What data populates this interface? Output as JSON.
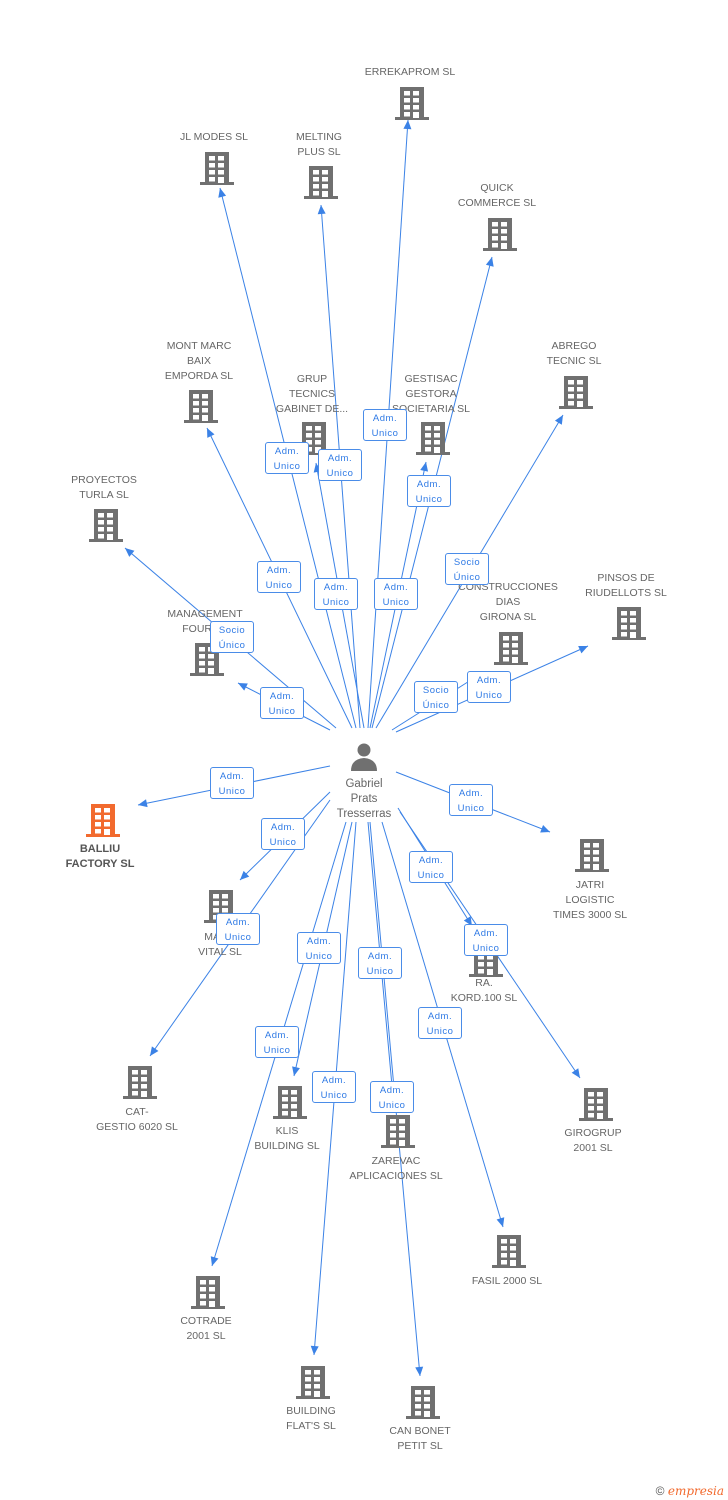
{
  "center": {
    "name_lines": [
      "Gabriel",
      "Prats",
      "Tresserras"
    ],
    "icon": "person-icon"
  },
  "colors": {
    "edge": "#3b82e6",
    "node": "#707070",
    "highlight": "#f26a2e",
    "label_text": "#2f7ae5"
  },
  "nodes": [
    {
      "lines": [
        "ERREKAPROM SL"
      ]
    },
    {
      "lines": [
        "JL MODES  SL"
      ]
    },
    {
      "lines": [
        "MELTING",
        "PLUS SL"
      ]
    },
    {
      "lines": [
        "QUICK",
        "COMMERCE SL"
      ]
    },
    {
      "lines": [
        "MONT MARC",
        "BAIX",
        "EMPORDA SL"
      ]
    },
    {
      "lines": [
        "GRUP",
        "TECNICS",
        "GABINET DE..."
      ]
    },
    {
      "lines": [
        "GESTISAC",
        "GESTORA",
        "SOCIETARIA SL"
      ]
    },
    {
      "lines": [
        "ABREGO",
        "TECNIC SL"
      ]
    },
    {
      "lines": [
        "PROYECTOS",
        "TURLA SL"
      ]
    },
    {
      "lines": [
        "MANAGEMENT",
        "FOURS..."
      ]
    },
    {
      "lines": [
        "CONSTRUCCIONES",
        "DIAS",
        "GIRONA SL"
      ]
    },
    {
      "lines": [
        "PINSOS DE",
        "RIUDELLOTS SL"
      ]
    },
    {
      "lines": [
        "BALLIU",
        "FACTORY SL"
      ],
      "highlight": true
    },
    {
      "lines": [
        "JATRI",
        "LOGISTIC",
        "TIMES 3000  SL"
      ]
    },
    {
      "lines": [
        "MAS...",
        "VITAL SL"
      ]
    },
    {
      "lines": [
        "RA.",
        "KORD.100 SL"
      ]
    },
    {
      "lines": [
        "CAT-",
        "GESTIO 6020 SL"
      ]
    },
    {
      "lines": [
        "KLIS",
        "BUILDING SL"
      ]
    },
    {
      "lines": [
        "ZAREVAC",
        "APLICACIONES SL"
      ]
    },
    {
      "lines": [
        "GIROGRUP",
        "2001 SL"
      ]
    },
    {
      "lines": [
        "FASIL 2000 SL"
      ]
    },
    {
      "lines": [
        "COTRADE",
        "2001 SL"
      ]
    },
    {
      "lines": [
        "BUILDING",
        "FLAT'S SL"
      ]
    },
    {
      "lines": [
        "CAN BONET",
        "PETIT SL"
      ]
    }
  ],
  "edges": [
    {
      "to": 0,
      "lines": [
        "Adm.",
        "Unico"
      ]
    },
    {
      "to": 1,
      "lines": [
        "Adm.",
        "Unico"
      ]
    },
    {
      "to": 2,
      "lines": [
        "Adm.",
        "Unico"
      ]
    },
    {
      "to": 3,
      "lines": [
        "Adm.",
        "Unico"
      ]
    },
    {
      "to": 4,
      "lines": [
        "Adm.",
        "Unico"
      ]
    },
    {
      "to": 5,
      "lines": [
        "Adm.",
        "Unico"
      ]
    },
    {
      "to": 6,
      "lines": [
        "Adm.",
        "Unico"
      ]
    },
    {
      "to": 7,
      "lines": [
        "Socio",
        "Único"
      ]
    },
    {
      "to": 8,
      "lines": [
        "Socio",
        "Único"
      ]
    },
    {
      "to": 9,
      "lines": [
        "Adm.",
        "Unico"
      ]
    },
    {
      "to": 10,
      "lines": [
        "Socio",
        "Único"
      ]
    },
    {
      "to": 11,
      "lines": [
        "Adm.",
        "Unico"
      ]
    },
    {
      "to": 12,
      "lines": [
        "Adm.",
        "Unico"
      ]
    },
    {
      "to": 13,
      "lines": [
        "Adm.",
        "Unico"
      ]
    },
    {
      "to": 14,
      "lines": [
        "Adm.",
        "Unico"
      ]
    },
    {
      "to": 15,
      "lines": [
        "Adm.",
        "Unico"
      ]
    },
    {
      "to": 16,
      "lines": [
        "Adm.",
        "Unico"
      ]
    },
    {
      "to": 19,
      "lines": [
        "Adm.",
        "Unico"
      ]
    },
    {
      "to": 17,
      "lines": [
        "Adm.",
        "Unico"
      ]
    },
    {
      "to": 18,
      "lines": [
        "Adm.",
        "Unico"
      ]
    },
    {
      "to": 20,
      "lines": [
        "Adm.",
        "Unico"
      ]
    },
    {
      "to": 21,
      "lines": [
        "Adm.",
        "Unico"
      ]
    },
    {
      "to": 22,
      "lines": [
        "Adm.",
        "Unico"
      ]
    },
    {
      "to": 23,
      "lines": [
        "Adm.",
        "Unico"
      ]
    }
  ],
  "footer": {
    "copyright": "©",
    "brand": "empresia"
  }
}
